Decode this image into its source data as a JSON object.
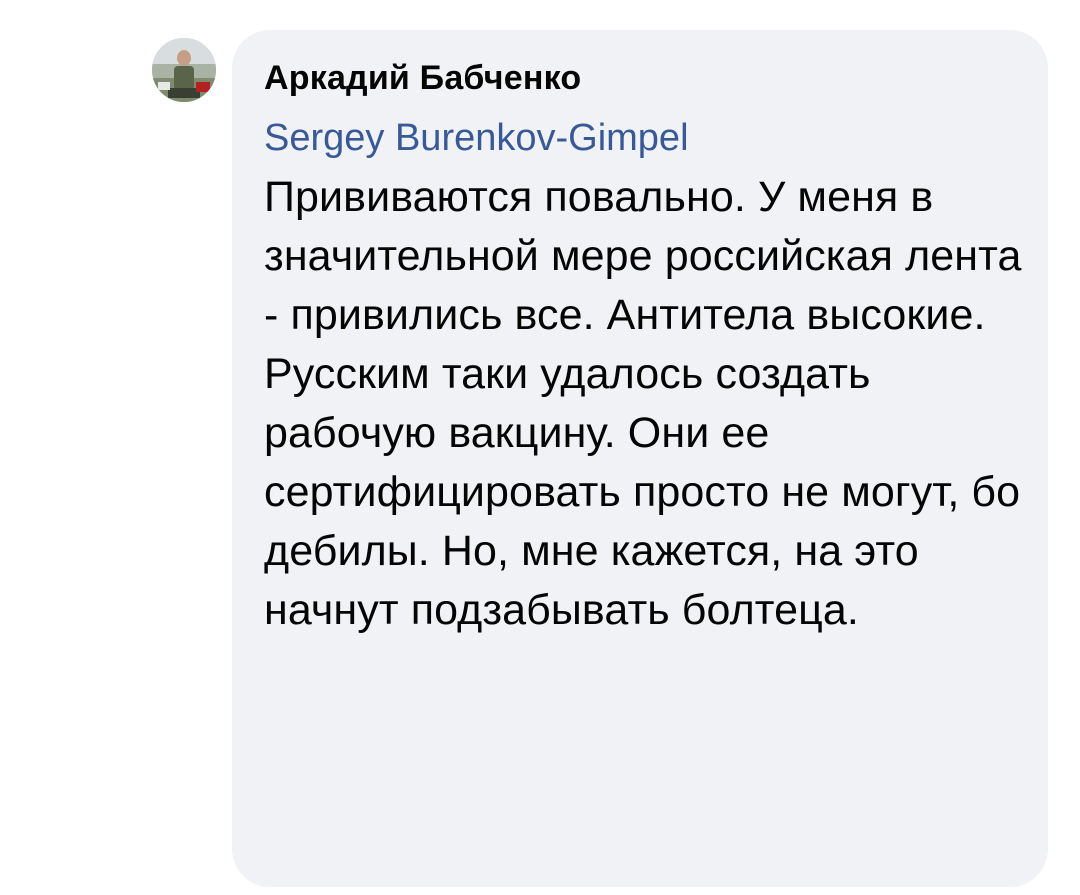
{
  "comment": {
    "author": "Аркадий Бабченко",
    "mention": "Sergey Burenkov-Gimpel",
    "text": "Прививаются повально. У меня в значительной мере российская лента - привились все. Антитела высокие. Русским таки удалось создать рабочую вакцину. Они ее сертифицировать просто не могут, бо дебилы. Но, мне кажется, на это начнут подзабывать болтеца."
  },
  "colors": {
    "bubble_background": "#f0f2f5",
    "author_text": "#050505",
    "mention_link": "#385898",
    "body_text": "#050505"
  }
}
